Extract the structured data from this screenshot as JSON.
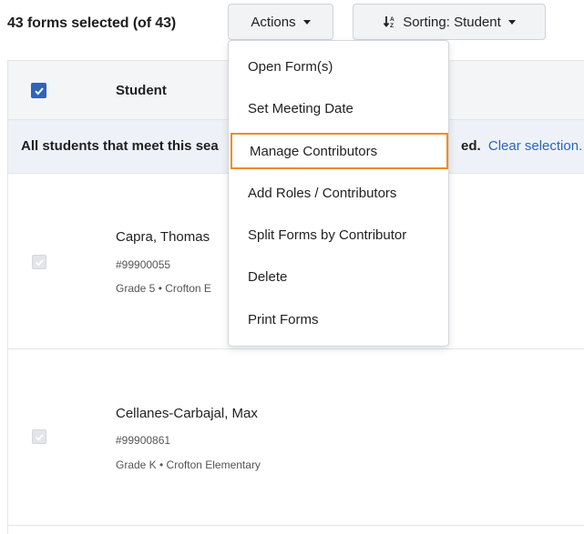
{
  "toolbar": {
    "selected_text": "43 forms selected (of 43)",
    "actions_label": "Actions",
    "sorting_label": "Sorting: Student"
  },
  "table": {
    "header": {
      "student_label": "Student"
    },
    "banner": {
      "text": "All students that meet this sea",
      "tail_bold": "ed.",
      "link": "Clear selection."
    },
    "rows": [
      {
        "name": "Capra, Thomas",
        "id": "#99900055",
        "grade": "Grade 5 • Crofton E"
      },
      {
        "name": "Cellanes-Carbajal, Max",
        "id": "#99900861",
        "grade": "Grade K • Crofton Elementary"
      }
    ]
  },
  "actions_menu": {
    "items": [
      "Open Form(s)",
      "Set Meeting Date",
      "Manage Contributors",
      "Add Roles / Contributors",
      "Split Forms by Contributor",
      "Delete",
      "Print Forms"
    ],
    "highlighted_index": 2
  },
  "colors": {
    "accent_blue": "#2d64bd",
    "highlight_orange": "#f08c1a",
    "banner_bg": "#eef2f8",
    "header_bg": "#f4f5f7"
  },
  "icons": [
    "caret-down-icon",
    "sort-az-icon",
    "checkmark-icon"
  ]
}
